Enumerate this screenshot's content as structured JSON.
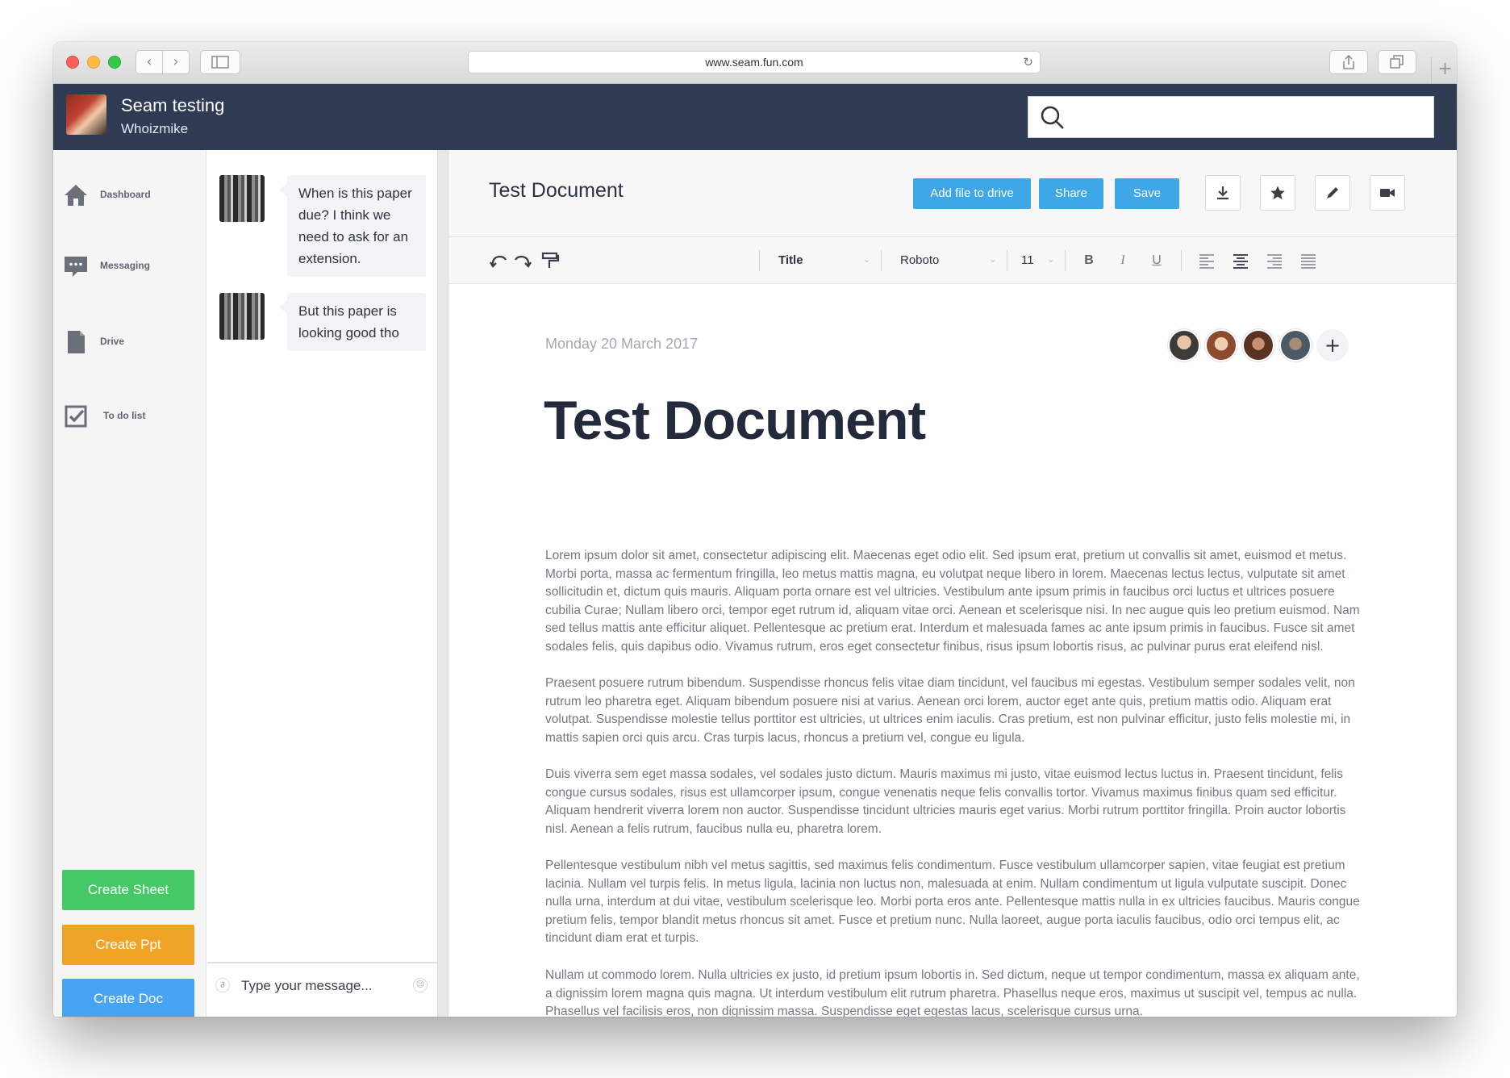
{
  "browser": {
    "url": "www.seam.fun.com",
    "back_glyph": "‹",
    "forward_glyph": "›",
    "reload_glyph": "↻",
    "new_tab_glyph": "+"
  },
  "header": {
    "title": "Seam testing",
    "user": "Whoizmike",
    "search": {
      "value": "",
      "placeholder": ""
    }
  },
  "nav": {
    "items": [
      {
        "label": "Dashboard",
        "icon": "home-icon"
      },
      {
        "label": "Messaging",
        "icon": "chat-icon"
      },
      {
        "label": "Drive",
        "icon": "file-icon"
      },
      {
        "label": "To do list",
        "icon": "checkbox-icon"
      }
    ],
    "buttons": {
      "sheet": "Create Sheet",
      "ppt": "Create Ppt",
      "doc": "Create Doc"
    },
    "colors": {
      "sheet": "#45c866",
      "ppt": "#efa428",
      "doc": "#48a3f5"
    }
  },
  "chat": {
    "messages": [
      {
        "text": "When is this paper due? I think we need to ask for an extension."
      },
      {
        "text": "But this paper is looking good tho"
      }
    ],
    "input": {
      "value": "",
      "placeholder": "Type your message..."
    },
    "clip_glyph": "∂",
    "emoji_glyph": "☺"
  },
  "document": {
    "toolbar_title": "Test Document",
    "actions": {
      "add_to_drive": "Add file to drive",
      "share": "Share",
      "save": "Save"
    },
    "accent": "#3ea7e6",
    "icon_buttons": [
      "download-icon",
      "star-icon",
      "pen-icon",
      "video-icon"
    ],
    "format": {
      "style": "Title",
      "font": "Roboto",
      "size": "11",
      "bold": "B",
      "italic": "I",
      "underline": "U",
      "caret": "⌄"
    },
    "date": "Monday 20 March 2017",
    "add_collaborator": "+",
    "heading": "Test Document",
    "paragraphs": [
      "Lorem ipsum dolor sit amet, consectetur adipiscing elit. Maecenas eget odio elit. Sed ipsum erat, pretium ut convallis sit amet, euismod et metus. Morbi porta, massa ac fermentum fringilla, leo metus mattis magna, eu volutpat neque libero in lorem. Maecenas lectus lectus, vulputate sit amet sollicitudin et, dictum quis mauris. Aliquam porta ornare est vel ultricies. Vestibulum ante ipsum primis in faucibus orci luctus et ultrices posuere cubilia Curae; Nullam libero orci, tempor eget rutrum id, aliquam vitae orci. Aenean et scelerisque nisi. In nec augue quis leo pretium euismod. Nam sed tellus mattis ante efficitur aliquet. Pellentesque ac pretium erat. Interdum et malesuada fames ac ante ipsum primis in faucibus. Fusce sit amet sodales felis, quis dapibus odio. Vivamus rutrum, eros eget consectetur finibus, risus ipsum lobortis risus, ac pulvinar purus erat eleifend nisl.",
      "Praesent posuere rutrum bibendum. Suspendisse rhoncus felis vitae diam tincidunt, vel faucibus mi egestas. Vestibulum semper sodales velit, non rutrum leo pharetra eget. Aliquam bibendum posuere nisi at varius. Aenean orci lorem, auctor eget ante quis, pretium mattis odio. Aliquam erat volutpat. Suspendisse molestie tellus porttitor est ultricies, ut ultrices enim iaculis. Cras pretium, est non pulvinar efficitur, justo felis molestie mi, in mattis sapien orci quis arcu. Cras turpis lacus, rhoncus a pretium vel, congue eu ligula.",
      "Duis viverra sem eget massa sodales, vel sodales justo dictum. Mauris maximus mi justo, vitae euismod lectus luctus in. Praesent tincidunt, felis congue cursus sodales, risus est ullamcorper ipsum, congue venenatis neque felis convallis tortor. Vivamus maximus finibus quam sed efficitur. Aliquam hendrerit viverra lorem non auctor. Suspendisse tincidunt ultricies mauris eget varius. Morbi rutrum porttitor fringilla. Proin auctor lobortis nisl. Aenean a felis rutrum, faucibus nulla eu, pharetra lorem.",
      "Pellentesque vestibulum nibh vel metus sagittis, sed maximus felis condimentum. Fusce vestibulum ullamcorper sapien, vitae feugiat est pretium lacinia. Nullam vel turpis felis. In metus ligula, lacinia non luctus non, malesuada at enim. Nullam condimentum ut ligula vulputate suscipit. Donec nulla urna, interdum at dui vitae, vestibulum scelerisque leo. Morbi porta eros ante. Pellentesque mattis nulla in ex ultricies faucibus. Mauris congue pretium felis, tempor blandit metus rhoncus sit amet. Fusce et pretium nunc. Nulla laoreet, augue porta iaculis faucibus, odio orci tempus elit, ac tincidunt diam erat et turpis.",
      "Nullam ut commodo lorem. Nulla ultricies ex justo, id pretium ipsum lobortis in. Sed dictum, neque ut tempor condimentum, massa ex aliquam ante, a dignissim lorem magna quis magna. Ut interdum vestibulum elit rutrum pharetra. Phasellus neque eros, maximus ut suscipit vel, tempus ac nulla. Phasellus vel facilisis eros, non dignissim massa. Suspendisse eget egestas lacus, scelerisque cursus urna."
    ]
  }
}
